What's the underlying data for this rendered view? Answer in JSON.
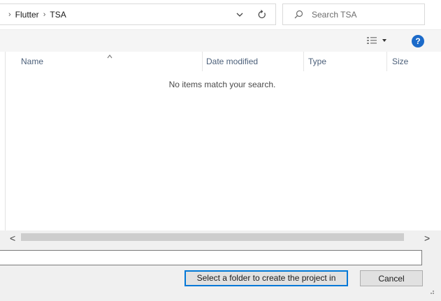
{
  "breadcrumb": {
    "prefix": "›",
    "items": [
      "Flutter",
      "TSA"
    ]
  },
  "search": {
    "placeholder": "Search TSA"
  },
  "toolbar": {
    "help_label": "?"
  },
  "columns": {
    "name": "Name",
    "date_modified": "Date modified",
    "type": "Type",
    "size": "Size"
  },
  "list": {
    "empty_message": "No items match your search."
  },
  "scrollbar": {
    "left_arrow": "<",
    "right_arrow": ">"
  },
  "filename": {
    "value": ""
  },
  "buttons": {
    "select_folder": "Select a folder to create the project in",
    "cancel": "Cancel"
  },
  "colors": {
    "accent": "#0078d7",
    "help": "#1b6ac9",
    "header_text": "#4c607a"
  },
  "icons": [
    "chevron-down-icon",
    "refresh-icon",
    "search-icon",
    "view-details-icon",
    "help-icon",
    "sort-up-icon",
    "resize-grip-icon"
  ]
}
